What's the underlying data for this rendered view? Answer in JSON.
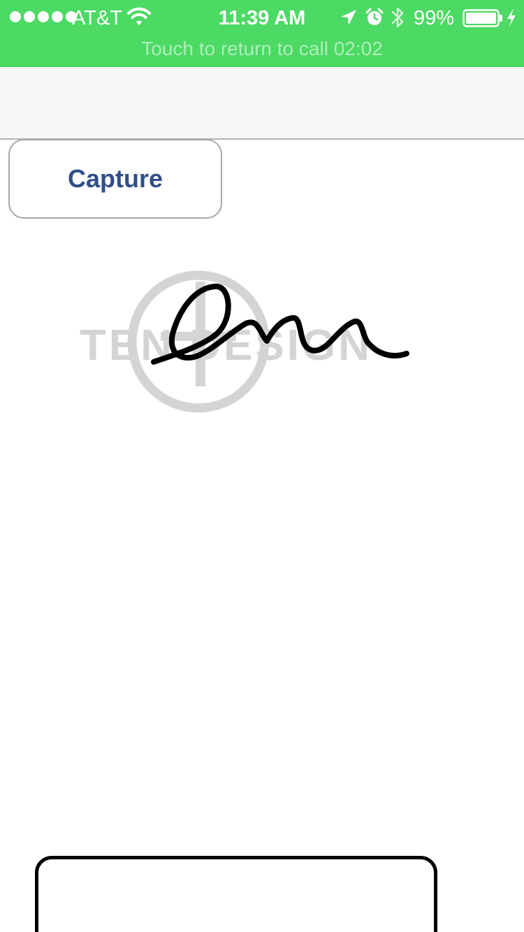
{
  "status_bar": {
    "carrier": "AT&T",
    "time": "11:39 AM",
    "battery_percent": "99%",
    "signal_dots": 5,
    "icons": [
      "wifi-icon",
      "location-arrow-icon",
      "alarm-clock-icon",
      "bluetooth-icon",
      "battery-icon",
      "charging-bolt-icon"
    ],
    "background_color": "#4cd964"
  },
  "call_banner": {
    "text": "Touch to return to call  02:02"
  },
  "toolbar": {
    "capture_label": "Capture",
    "capture_color": "#314e88"
  },
  "watermark": {
    "text": "TEN DESIGN",
    "color": "#d4d4d4"
  },
  "signature": {
    "stroke_color": "#000000",
    "present": true
  }
}
